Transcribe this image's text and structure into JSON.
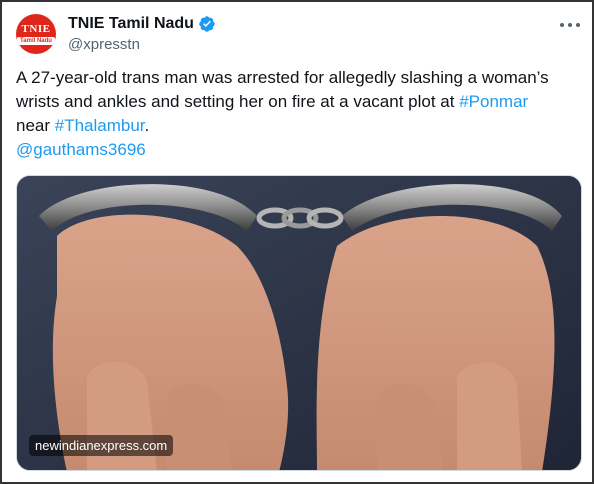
{
  "tweet": {
    "avatar": {
      "logo_main": "TNIE",
      "logo_sub": "Tamil Nadu"
    },
    "author_name": "TNIE Tamil Nadu",
    "handle": "@xpresstn",
    "verified_icon": "verified-badge-icon",
    "more_icon": "more-options-icon",
    "text": {
      "part1": "A 27-year-old trans man was arrested for allegedly slashing a woman’s wrists and ankles and setting her on fire at a vacant plot at ",
      "hashtag1": "#Ponmar",
      "part2": " near ",
      "hashtag2": "#Thalambur",
      "part3": ".",
      "mention": "@gauthams3696"
    },
    "media": {
      "watermark": "newindianexpress.com"
    }
  },
  "colors": {
    "link": "#1d9bf0",
    "avatar_bg": "#e0261b",
    "secondary_text": "#536471"
  }
}
